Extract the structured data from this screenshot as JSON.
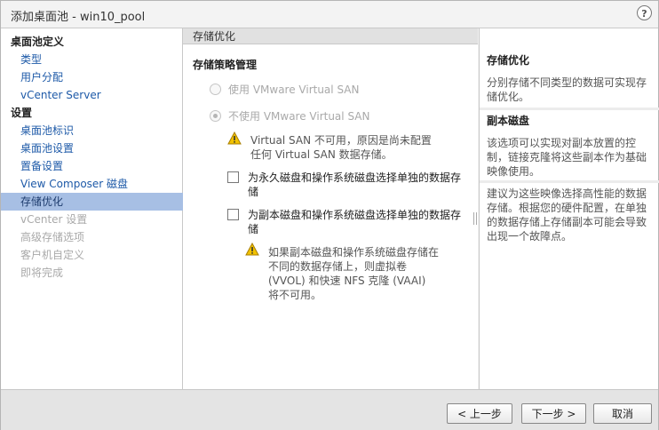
{
  "window": {
    "title": "添加桌面池 - win10_pool",
    "help_label": "?"
  },
  "nav": {
    "items": [
      {
        "label": "桌面池定义",
        "kind": "group"
      },
      {
        "label": "类型",
        "kind": "link"
      },
      {
        "label": "用户分配",
        "kind": "link"
      },
      {
        "label": "vCenter Server",
        "kind": "link"
      },
      {
        "label": "设置",
        "kind": "group"
      },
      {
        "label": "桌面池标识",
        "kind": "link"
      },
      {
        "label": "桌面池设置",
        "kind": "link"
      },
      {
        "label": "置备设置",
        "kind": "link"
      },
      {
        "label": "View Composer 磁盘",
        "kind": "link"
      },
      {
        "label": "存储优化",
        "kind": "selected"
      },
      {
        "label": "vCenter 设置",
        "kind": "disabled"
      },
      {
        "label": "高级存储选项",
        "kind": "disabled"
      },
      {
        "label": "客户机自定义",
        "kind": "disabled"
      },
      {
        "label": "即将完成",
        "kind": "disabled"
      }
    ]
  },
  "main": {
    "section_title": "存储优化",
    "policy_title": "存储策略管理",
    "radio_use_vsan": "使用 VMware Virtual SAN",
    "radio_no_vsan": "不使用 VMware Virtual SAN",
    "vsan_warning": [
      "Virtual SAN 不可用，原因是尚未配置",
      "任何 Virtual SAN 数据存储。"
    ],
    "checkbox_persistent": [
      "为永久磁盘和操作系统磁盘选择单独的数据存",
      "储"
    ],
    "checkbox_replica": [
      "为副本磁盘和操作系统磁盘选择单独的数据存",
      "储"
    ],
    "replica_warning": [
      "如果副本磁盘和操作系统磁盘存储在",
      "不同的数据存储上，则虚拟卷",
      "(VVOL) 和快速 NFS 克隆 (VAAI)",
      "将不可用。"
    ]
  },
  "help_pane": {
    "title1": "存储优化",
    "text1": [
      "分别存储不同类型的数据可实现存",
      "储优化。"
    ],
    "title2": "副本磁盘",
    "text2": [
      "该选项可以实现对副本放置的控",
      "制，链接克隆将这些副本作为基础",
      "映像使用。"
    ],
    "text3": [
      "建议为这些映像选择高性能的数据",
      "存储。根据您的硬件配置，在单独",
      "的数据存储上存储副本可能会导致",
      "出现一个故障点。"
    ]
  },
  "footer": {
    "back": "< 上一步",
    "next": "下一步 >",
    "cancel": "取消"
  },
  "colors": {
    "selected_nav": "#a7bfe4",
    "link": "#1e5aa8",
    "warning": "#f2c200"
  }
}
